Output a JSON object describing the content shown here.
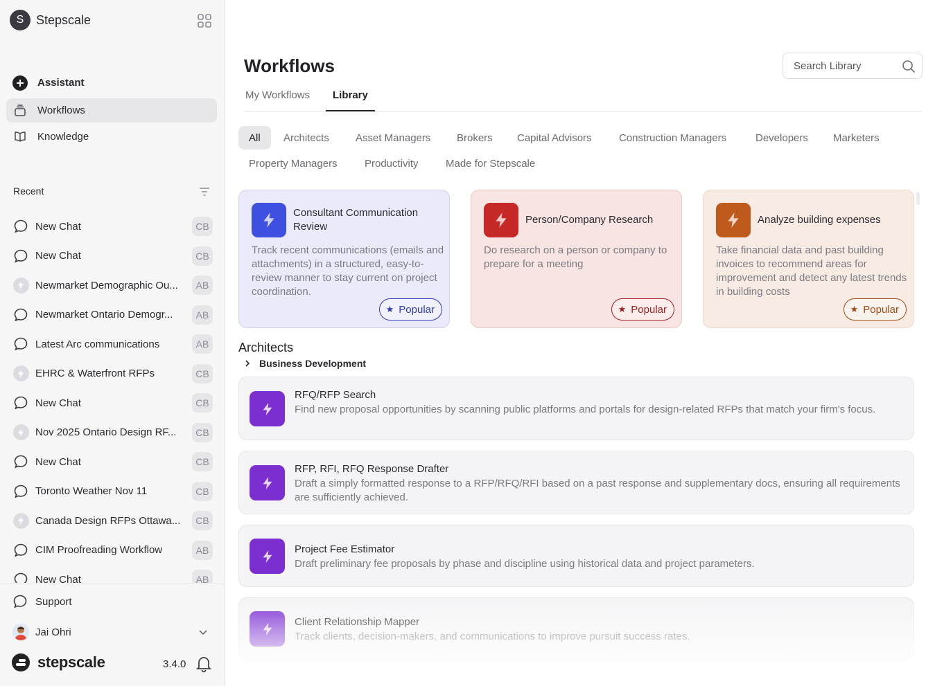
{
  "workspace": {
    "initial": "S",
    "name": "Stepscale"
  },
  "nav": [
    {
      "label": "Assistant",
      "icon": "plus-circle-icon"
    },
    {
      "label": "Workflows",
      "icon": "stack-icon"
    },
    {
      "label": "Knowledge",
      "icon": "book-icon"
    }
  ],
  "recent": {
    "heading": "Recent",
    "items": [
      {
        "label": "New Chat",
        "type": "chat",
        "initials": "CB"
      },
      {
        "label": "New Chat",
        "type": "chat",
        "initials": "CB"
      },
      {
        "label": "Newmarket Demographic Ou...",
        "type": "workflow",
        "initials": "AB"
      },
      {
        "label": "Newmarket Ontario Demogr...",
        "type": "chat",
        "initials": "AB"
      },
      {
        "label": "Latest Arc communications",
        "type": "chat",
        "initials": "AB"
      },
      {
        "label": "EHRC & Waterfront RFPs",
        "type": "workflow",
        "initials": "CB"
      },
      {
        "label": "New Chat",
        "type": "chat",
        "initials": "CB"
      },
      {
        "label": "Nov 2025 Ontario Design RF...",
        "type": "workflow",
        "initials": "CB"
      },
      {
        "label": "New Chat",
        "type": "chat",
        "initials": "CB"
      },
      {
        "label": "Toronto Weather Nov 11",
        "type": "chat",
        "initials": "CB"
      },
      {
        "label": "Canada Design RFPs Ottawa...",
        "type": "workflow",
        "initials": "CB"
      },
      {
        "label": "CIM Proofreading Workflow",
        "type": "chat",
        "initials": "AB"
      },
      {
        "label": "New Chat",
        "type": "chat",
        "initials": "AB"
      }
    ]
  },
  "support": {
    "label": "Support"
  },
  "user": {
    "name": "Jai Ohri"
  },
  "brand": {
    "name": "stepscale",
    "version": "3.4.0"
  },
  "page": {
    "title": "Workflows"
  },
  "search": {
    "placeholder": "Search Library"
  },
  "tabs": [
    {
      "label": "My Workflows",
      "active": false
    },
    {
      "label": "Library",
      "active": true
    }
  ],
  "filters": [
    "All",
    "Architects",
    "Asset Managers",
    "Brokers",
    "Capital Advisors",
    "Construction Managers",
    "Developers",
    "Marketers",
    "Property Managers",
    "Productivity",
    "Made for Stepscale"
  ],
  "featured": [
    {
      "title": "Consultant Communication Review",
      "description": "Track recent communications (emails and attachments) in a structured, easy-to-review manner to stay current on project coordination.",
      "badge": "Popular",
      "colors": {
        "bg": "#eaeafa",
        "border": "#cfd1f2",
        "tile": "#3f4fe0",
        "accent": "#2f3bb8"
      }
    },
    {
      "title": "Person/Company Research",
      "description": "Do research on a person or company to prepare for a meeting",
      "badge": "Popular",
      "colors": {
        "bg": "#f8e4e2",
        "border": "#efc9c4",
        "tile": "#c62828",
        "accent": "#a51e1e"
      }
    },
    {
      "title": "Analyze building expenses",
      "description": "Take financial data and past building invoices to recommend areas for improvement and detect any latest trends in building costs",
      "badge": "Popular",
      "colors": {
        "bg": "#f8ebe3",
        "border": "#efd6c7",
        "tile": "#bf5a1d",
        "accent": "#a34a14"
      }
    }
  ],
  "section": {
    "title": "Architects",
    "subsection": "Business Development",
    "workflows": [
      {
        "title": "RFQ/RFP Search",
        "description": "Find new proposal opportunities by scanning public platforms and portals for design-related RFPs that match your firm's focus."
      },
      {
        "title": "RFP, RFI, RFQ Response Drafter",
        "description": "Draft a simply formatted response to a RFP/RFQ/RFI based on a past response and supplementary docs, ensuring all requirements are sufficiently achieved."
      },
      {
        "title": "Project Fee Estimator",
        "description": "Draft preliminary fee proposals by phase and discipline using historical data and project parameters."
      },
      {
        "title": "Client Relationship Mapper",
        "description": "Track clients, decision-makers, and communications to improve pursuit success rates."
      }
    ]
  }
}
